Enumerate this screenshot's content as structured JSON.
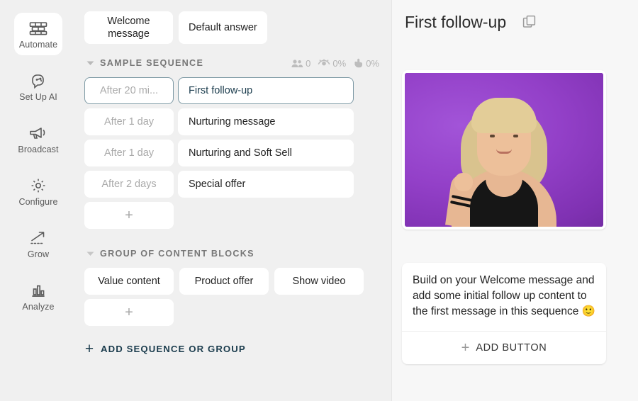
{
  "sidebar": {
    "items": [
      {
        "label": "Automate",
        "icon": "bricks-icon",
        "active": true
      },
      {
        "label": "Set Up AI",
        "icon": "ai-brain-icon",
        "active": false
      },
      {
        "label": "Broadcast",
        "icon": "megaphone-icon",
        "active": false
      },
      {
        "label": "Configure",
        "icon": "gear-icon",
        "active": false
      },
      {
        "label": "Grow",
        "icon": "growth-arrow-icon",
        "active": false
      },
      {
        "label": "Analyze",
        "icon": "bar-chart-icon",
        "active": false
      }
    ]
  },
  "flow": {
    "top_chips": [
      {
        "label": "Welcome message"
      },
      {
        "label": "Default answer"
      }
    ],
    "sequence": {
      "title": "SAMPLE SEQUENCE",
      "stats": [
        {
          "icon": "people-icon",
          "value": "0"
        },
        {
          "icon": "eye-icon",
          "value": "0%"
        },
        {
          "icon": "click-hand-icon",
          "value": "0%"
        }
      ],
      "rows": [
        {
          "delay": "After 20 mi...",
          "title": "First follow-up",
          "selected": true
        },
        {
          "delay": "After 1 day",
          "title": "Nurturing message",
          "selected": false
        },
        {
          "delay": "After 1 day",
          "title": "Nurturing and Soft Sell",
          "selected": false
        },
        {
          "delay": "After 2 days",
          "title": "Special offer",
          "selected": false
        }
      ],
      "add_label": "+"
    },
    "group": {
      "title": "GROUP OF CONTENT BLOCKS",
      "blocks": [
        {
          "label": "Value content"
        },
        {
          "label": "Product offer"
        },
        {
          "label": "Show video"
        }
      ],
      "add_label": "+"
    },
    "add_sequence": {
      "plus": "+",
      "label": "ADD SEQUENCE OR GROUP"
    }
  },
  "preview": {
    "title": "First follow-up",
    "copy_icon": "copy-icon",
    "image_alt": "blonde woman on purple background",
    "message_text": "Build on your Welcome message and add some initial follow up content to the first message in this sequence 🙂",
    "add_button": {
      "plus": "+",
      "label": "ADD BUTTON"
    }
  },
  "colors": {
    "accent_navy": "#1b3c4d",
    "selected_border": "#7e9aa5",
    "panel_left_bg": "#f0f0f0",
    "panel_right_bg": "#f7f7f7",
    "image_purple": "#9340c8"
  }
}
